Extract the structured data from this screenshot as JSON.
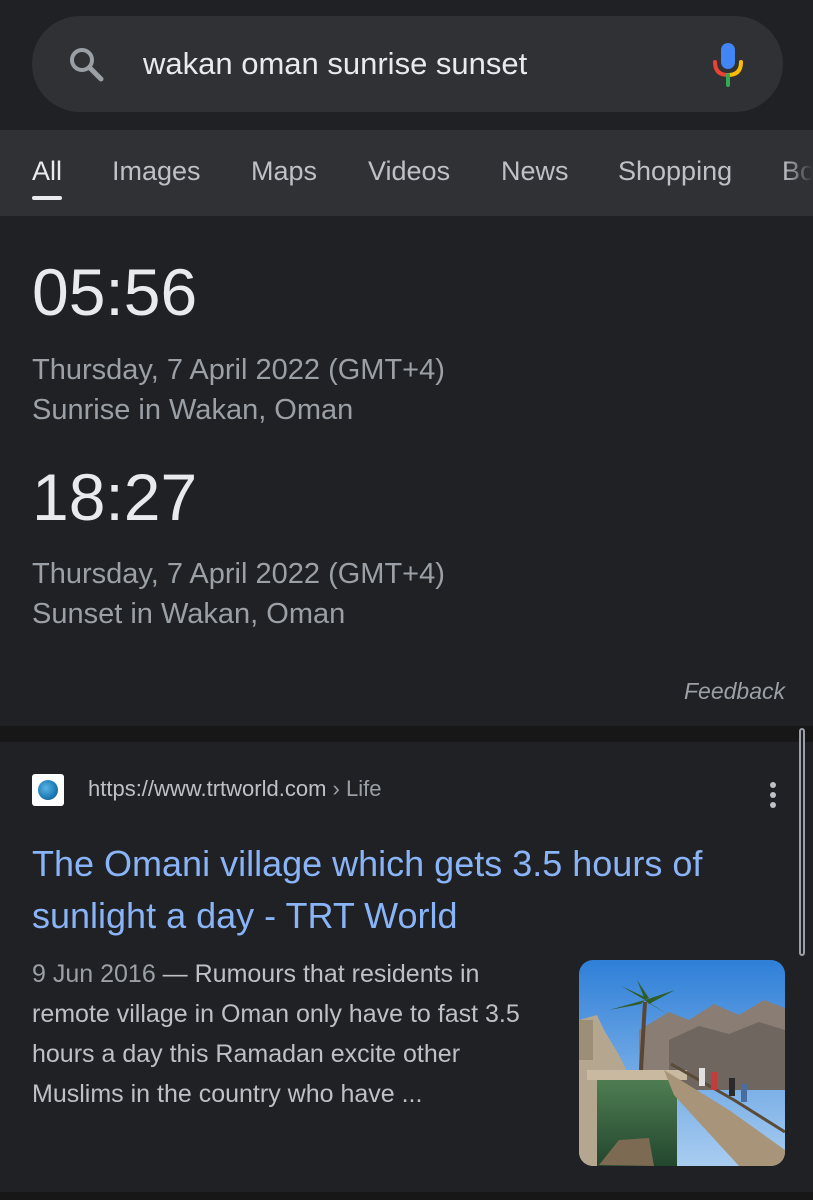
{
  "search": {
    "query": "wakan oman sunrise sunset"
  },
  "tabs": [
    {
      "label": "All",
      "active": true
    },
    {
      "label": "Images"
    },
    {
      "label": "Maps"
    },
    {
      "label": "Videos"
    },
    {
      "label": "News"
    },
    {
      "label": "Shopping"
    },
    {
      "label": "Bo"
    }
  ],
  "sun_card": {
    "sunrise": {
      "time": "05:56",
      "date": "Thursday, 7 April 2022 (GMT+4)",
      "caption": "Sunrise in Wakan, Oman"
    },
    "sunset": {
      "time": "18:27",
      "date": "Thursday, 7 April 2022 (GMT+4)",
      "caption": "Sunset in Wakan, Oman"
    },
    "feedback": "Feedback"
  },
  "result": {
    "url": "https://www.trtworld.com",
    "breadcrumb": "› Life",
    "title": "The Omani village which gets 3.5 hours of sunlight a day - TRT World",
    "date": "9 Jun 2016",
    "snippet": " — Rumours that residents in remote village in Oman only have to fast 3.5 hours a day this Ramadan excite other Muslims in the country who have ..."
  },
  "colors": {
    "background": "#202124",
    "surface": "#303134",
    "link": "#8ab4f8",
    "text": "#e8eaed",
    "muted": "#9aa0a6"
  }
}
